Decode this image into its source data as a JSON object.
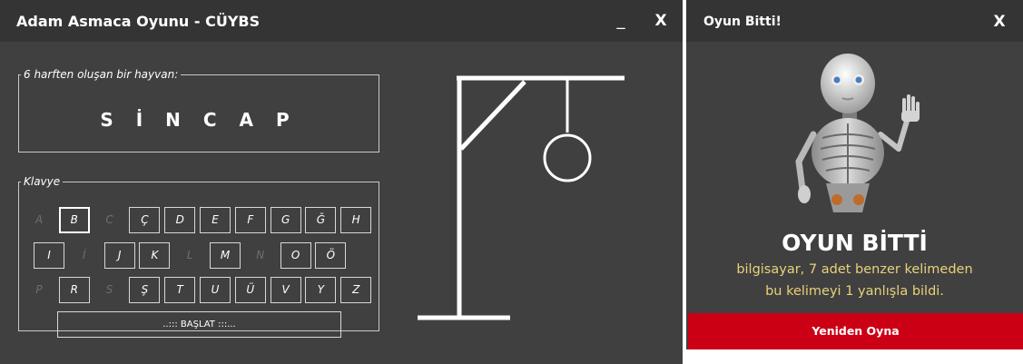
{
  "main_window": {
    "title": "Adam Asmaca Oyunu - CÜYBS",
    "minimize_label": "_",
    "close_label": "X"
  },
  "word_panel": {
    "hint": "6 harften oluşan bir hayvan:",
    "word": "S İ N C A P"
  },
  "keyboard": {
    "legend": "Klavye",
    "rows": [
      [
        "A",
        "B",
        "C",
        "Ç",
        "D",
        "E",
        "F",
        "G",
        "Ğ",
        "H"
      ],
      [
        "I",
        "İ",
        "J",
        "K",
        "L",
        "M",
        "N",
        "O",
        "Ö"
      ],
      [
        "P",
        "R",
        "S",
        "Ş",
        "T",
        "U",
        "Ü",
        "V",
        "Y",
        "Z"
      ]
    ],
    "pressed_letters": [
      "A",
      "C",
      "İ",
      "L",
      "N",
      "P",
      "S"
    ],
    "focused_letter": "B",
    "start_label": "..::: BAŞLAT :::..."
  },
  "dialog": {
    "title": "Oyun Bitti!",
    "close_label": "X",
    "heading": "OYUN BİTTİ",
    "message_line1": "bilgisayar, 7 adet benzer kelimeden",
    "message_line2": "bu kelimeyi 1 yanlışla bildi.",
    "replay_label": "Yeniden Oyna"
  },
  "colors": {
    "window_bg": "#404040",
    "titlebar_bg": "#343434",
    "accent_red": "#cc0014",
    "message_text": "#e8d27a"
  }
}
